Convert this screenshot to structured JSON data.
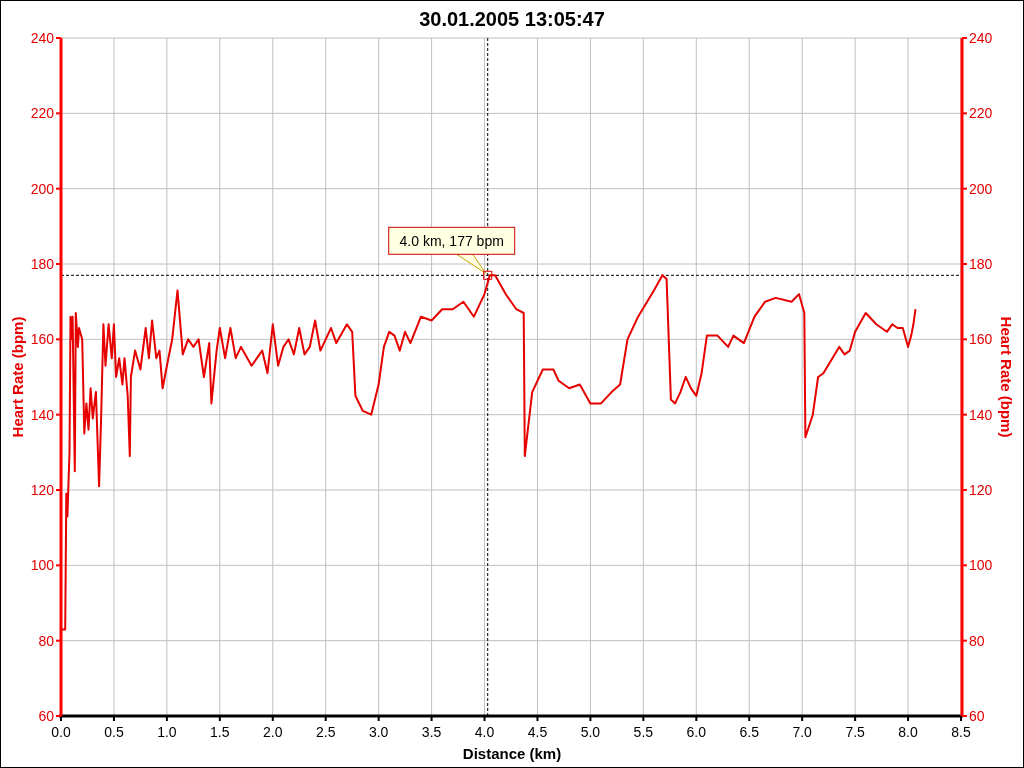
{
  "chart_data": {
    "type": "line",
    "title": "30.01.2005 13:05:47",
    "xlabel": "Distance (km)",
    "ylabel": "Heart Rate (bpm)",
    "y2label": "Heart Rate (bpm)",
    "xlim": [
      0,
      8.5
    ],
    "ylim": [
      60,
      240
    ],
    "y2lim": [
      60,
      240
    ],
    "grid": true,
    "ref_lines": [
      {
        "axis": "x",
        "value": 4.03
      },
      {
        "axis": "y",
        "value": 177
      }
    ],
    "xticks": [
      {
        "value": 0,
        "label": "0.0"
      },
      {
        "value": 0.5,
        "label": "0.5"
      },
      {
        "value": 1,
        "label": "1.0"
      },
      {
        "value": 1.5,
        "label": "1.5"
      },
      {
        "value": 2,
        "label": "2.0"
      },
      {
        "value": 2.5,
        "label": "2.5"
      },
      {
        "value": 3,
        "label": "3.0"
      },
      {
        "value": 3.5,
        "label": "3.5"
      },
      {
        "value": 4,
        "label": "4.0"
      },
      {
        "value": 4.5,
        "label": "4.5"
      },
      {
        "value": 5,
        "label": "5.0"
      },
      {
        "value": 5.5,
        "label": "5.5"
      },
      {
        "value": 6,
        "label": "6.0"
      },
      {
        "value": 6.5,
        "label": "6.5"
      },
      {
        "value": 7,
        "label": "7.0"
      },
      {
        "value": 7.5,
        "label": "7.5"
      },
      {
        "value": 8,
        "label": "8.0"
      },
      {
        "value": 8.5,
        "label": "8.5"
      }
    ],
    "yticks": [
      60,
      80,
      100,
      120,
      140,
      160,
      180,
      200,
      220,
      240
    ],
    "y2ticks": [
      60,
      80,
      100,
      120,
      140,
      160,
      180,
      200,
      220,
      240
    ],
    "x": [
      0,
      0.02,
      0.04,
      0.05,
      0.06,
      0.08,
      0.09,
      0.1,
      0.11,
      0.13,
      0.14,
      0.16,
      0.17,
      0.2,
      0.22,
      0.24,
      0.26,
      0.28,
      0.3,
      0.33,
      0.36,
      0.38,
      0.4,
      0.42,
      0.45,
      0.48,
      0.5,
      0.52,
      0.55,
      0.58,
      0.6,
      0.63,
      0.65,
      0.66,
      0.7,
      0.75,
      0.8,
      0.83,
      0.86,
      0.9,
      0.93,
      0.96,
      1,
      1.05,
      1.1,
      1.15,
      1.2,
      1.25,
      1.3,
      1.35,
      1.4,
      1.42,
      1.47,
      1.5,
      1.55,
      1.6,
      1.65,
      1.7,
      1.8,
      1.9,
      1.95,
      2,
      2.05,
      2.1,
      2.15,
      2.2,
      2.25,
      2.3,
      2.35,
      2.4,
      2.45,
      2.5,
      2.55,
      2.6,
      2.7,
      2.75,
      2.78,
      2.85,
      2.93,
      3,
      3.05,
      3.1,
      3.15,
      3.2,
      3.25,
      3.3,
      3.4,
      3.5,
      3.6,
      3.7,
      3.8,
      3.9,
      4,
      4.05,
      4.1,
      4.2,
      4.3,
      4.37,
      4.38,
      4.45,
      4.55,
      4.65,
      4.7,
      4.8,
      4.9,
      5,
      5.1,
      5.2,
      5.28,
      5.35,
      5.45,
      5.6,
      5.68,
      5.72,
      5.76,
      5.8,
      5.85,
      5.9,
      5.95,
      6,
      6.05,
      6.1,
      6.2,
      6.3,
      6.35,
      6.45,
      6.55,
      6.65,
      6.75,
      6.9,
      6.97,
      7.02,
      7.03,
      7.1,
      7.15,
      7.2,
      7.35,
      7.4,
      7.45,
      7.5,
      7.6,
      7.7,
      7.8,
      7.85,
      7.9,
      7.95,
      8,
      8.03,
      8.05,
      8.07
    ],
    "series": [
      {
        "color": "#e60000",
        "values": [
          83,
          83,
          83,
          119,
          113,
          130,
          166,
          160,
          166,
          125,
          167,
          158,
          163,
          160,
          135,
          143,
          136,
          147,
          139,
          146,
          121,
          140,
          164,
          153,
          164,
          155,
          164,
          150,
          155,
          148,
          155,
          145,
          129,
          150,
          157,
          152,
          163,
          155,
          165,
          155,
          157,
          147,
          153,
          160,
          173,
          156,
          160,
          158,
          160,
          150,
          159,
          143,
          157,
          163,
          155,
          163,
          155,
          158,
          153,
          157,
          151,
          164,
          153,
          158,
          160,
          156,
          163,
          156,
          158,
          165,
          157,
          160,
          163,
          159,
          164,
          162,
          145,
          141,
          140,
          148,
          158,
          162,
          161,
          157,
          162,
          159,
          166,
          165,
          168,
          168,
          170,
          166,
          172,
          177,
          177,
          172,
          168,
          167,
          129,
          146,
          152,
          152,
          149,
          147,
          148,
          143,
          143,
          146,
          148,
          160,
          166,
          173,
          177,
          176,
          144,
          143,
          146,
          150,
          147,
          145,
          151,
          161,
          161,
          158,
          161,
          159,
          166,
          170,
          171,
          170,
          172,
          167,
          134,
          140,
          150,
          151,
          158,
          156,
          157,
          162,
          167,
          164,
          162,
          164,
          163,
          163,
          158,
          161,
          164,
          168
        ]
      }
    ],
    "annotations": [
      {
        "text": "4.0 km, 177 bpm",
        "x": 4.03,
        "y": 177
      }
    ]
  }
}
